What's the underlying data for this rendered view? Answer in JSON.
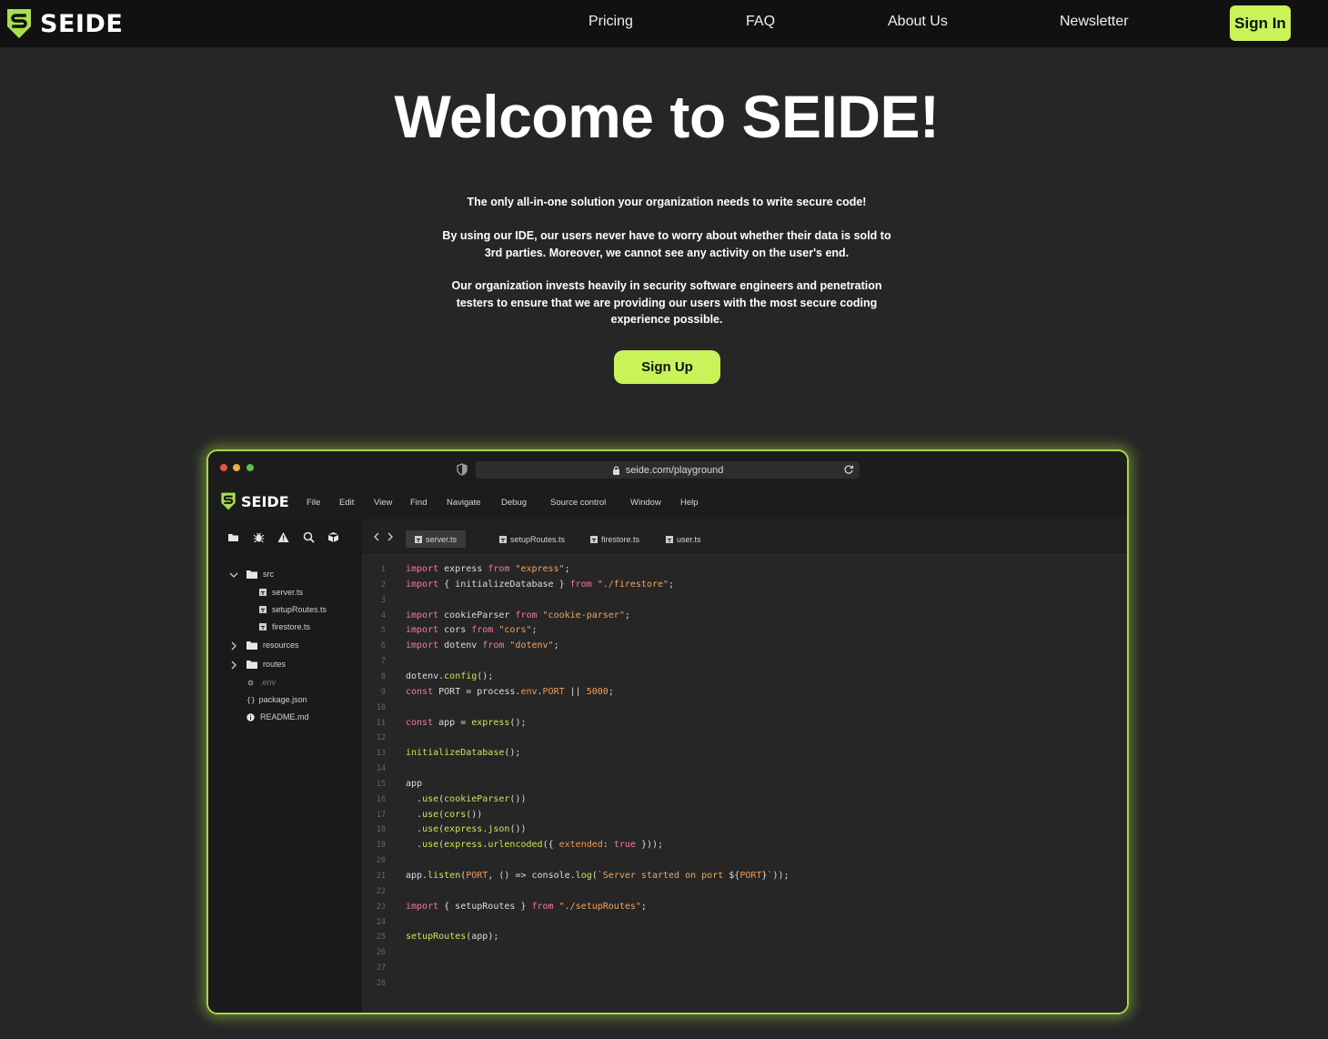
{
  "brand": {
    "name": "SEIDE",
    "accent": "#c8f45a",
    "logo_icon": "s-shield-logo-icon"
  },
  "nav": {
    "links": [
      "Pricing",
      "FAQ",
      "About Us",
      "Newsletter"
    ],
    "signin_label": "Sign In"
  },
  "hero": {
    "title": "Welcome to SEIDE!",
    "paragraphs": [
      "The only all-in-one solution your organization needs to write secure code!",
      "By using our IDE, our users never have to worry about whether their data is sold to 3rd parties. Moreover, we cannot see any activity on the user's end.",
      "Our organization invests heavily in security software engineers and penetration testers to ensure that we are providing our users with the most secure coding experience possible."
    ],
    "signup_label": "Sign Up"
  },
  "ide": {
    "url": "seide.com/playground",
    "brand_name": "SEIDE",
    "menu": [
      "File",
      "Edit",
      "View",
      "Find",
      "Navigate",
      "Debug",
      "Source control",
      "Window",
      "Help"
    ],
    "toolbar_icons": [
      "folder-icon",
      "bug-icon",
      "warning-icon",
      "search-icon",
      "package-icon"
    ],
    "tabs": [
      {
        "label": "server.ts",
        "active": true
      },
      {
        "label": "setupRoutes.ts",
        "active": false
      },
      {
        "label": "firestore.ts",
        "active": false
      },
      {
        "label": "user.ts",
        "active": false
      }
    ],
    "tree": [
      {
        "label": "src",
        "kind": "folder",
        "expanded": true,
        "depth": 0
      },
      {
        "label": "server.ts",
        "kind": "ts",
        "depth": 1
      },
      {
        "label": "setupRoutes.ts",
        "kind": "ts",
        "depth": 1
      },
      {
        "label": "firestore.ts",
        "kind": "ts",
        "depth": 1
      },
      {
        "label": "resources",
        "kind": "folder",
        "expanded": false,
        "depth": 0
      },
      {
        "label": "routes",
        "kind": "folder",
        "expanded": false,
        "depth": 0
      },
      {
        "label": ".env",
        "kind": "env",
        "depth": 0
      },
      {
        "label": "package.json",
        "kind": "json",
        "depth": 0
      },
      {
        "label": "README.md",
        "kind": "info",
        "depth": 0
      }
    ],
    "code_lines": [
      [
        [
          "kw",
          "import"
        ],
        [
          "plain",
          " express "
        ],
        [
          "kw",
          "from"
        ],
        [
          "str",
          " \"express\""
        ],
        [
          "plain",
          ";"
        ]
      ],
      [
        [
          "kw",
          "import"
        ],
        [
          "plain",
          " { initializeDatabase } "
        ],
        [
          "kw",
          "from"
        ],
        [
          "str",
          " \"./firestore\""
        ],
        [
          "plain",
          ";"
        ]
      ],
      [],
      [
        [
          "kw",
          "import"
        ],
        [
          "plain",
          " cookieParser "
        ],
        [
          "kw",
          "from"
        ],
        [
          "str",
          " \"cookie-parser\""
        ],
        [
          "plain",
          ";"
        ]
      ],
      [
        [
          "kw",
          "import"
        ],
        [
          "plain",
          " cors "
        ],
        [
          "kw",
          "from"
        ],
        [
          "str",
          " \"cors\""
        ],
        [
          "plain",
          ";"
        ]
      ],
      [
        [
          "kw",
          "import"
        ],
        [
          "plain",
          " dotenv "
        ],
        [
          "kw",
          "from"
        ],
        [
          "str",
          " \"dotenv\""
        ],
        [
          "plain",
          ";"
        ]
      ],
      [],
      [
        [
          "plain",
          "dotenv."
        ],
        [
          "fn",
          "config"
        ],
        [
          "plain",
          "();"
        ]
      ],
      [
        [
          "kw",
          "const"
        ],
        [
          "plain",
          " PORT = process."
        ],
        [
          "prop",
          "env"
        ],
        [
          "plain",
          "."
        ],
        [
          "prop",
          "PORT"
        ],
        [
          "plain",
          " || "
        ],
        [
          "str",
          "5000"
        ],
        [
          "plain",
          ";"
        ]
      ],
      [],
      [
        [
          "kw",
          "const"
        ],
        [
          "plain",
          " app = "
        ],
        [
          "fn",
          "express"
        ],
        [
          "plain",
          "();"
        ]
      ],
      [],
      [
        [
          "fn",
          "initializeDatabase"
        ],
        [
          "plain",
          "();"
        ]
      ],
      [],
      [
        [
          "plain",
          "app"
        ]
      ],
      [
        [
          "plain",
          "  ."
        ],
        [
          "fn",
          "use"
        ],
        [
          "plain",
          "("
        ],
        [
          "fn",
          "cookieParser"
        ],
        [
          "plain",
          "())"
        ]
      ],
      [
        [
          "plain",
          "  ."
        ],
        [
          "fn",
          "use"
        ],
        [
          "plain",
          "("
        ],
        [
          "fn",
          "cors"
        ],
        [
          "plain",
          "())"
        ]
      ],
      [
        [
          "plain",
          "  ."
        ],
        [
          "fn",
          "use"
        ],
        [
          "plain",
          "("
        ],
        [
          "fn",
          "express"
        ],
        [
          "plain",
          "."
        ],
        [
          "fn",
          "json"
        ],
        [
          "plain",
          "())"
        ]
      ],
      [
        [
          "plain",
          "  ."
        ],
        [
          "fn",
          "use"
        ],
        [
          "plain",
          "("
        ],
        [
          "fn",
          "express"
        ],
        [
          "plain",
          "."
        ],
        [
          "fn",
          "urlencoded"
        ],
        [
          "plain",
          "({ "
        ],
        [
          "prop",
          "extended"
        ],
        [
          "plain",
          ": "
        ],
        [
          "kw",
          "true"
        ],
        [
          "plain",
          " }));"
        ]
      ],
      [],
      [
        [
          "plain",
          "app."
        ],
        [
          "fn",
          "listen"
        ],
        [
          "plain",
          "("
        ],
        [
          "prop",
          "PORT"
        ],
        [
          "plain",
          ", () => console."
        ],
        [
          "fn",
          "log"
        ],
        [
          "plain",
          "("
        ],
        [
          "str",
          "`Server started on port "
        ],
        [
          "plain",
          "${"
        ],
        [
          "prop",
          "PORT"
        ],
        [
          "plain",
          "}"
        ],
        [
          "str",
          "`"
        ],
        [
          "plain",
          "));"
        ]
      ],
      [],
      [
        [
          "kw",
          "import"
        ],
        [
          "plain",
          " { setupRoutes } "
        ],
        [
          "kw",
          "from"
        ],
        [
          "str",
          " \"./setupRoutes\""
        ],
        [
          "plain",
          ";"
        ]
      ],
      [],
      [
        [
          "fn",
          "setupRoutes"
        ],
        [
          "plain",
          "(app);"
        ]
      ],
      [],
      [],
      []
    ]
  }
}
